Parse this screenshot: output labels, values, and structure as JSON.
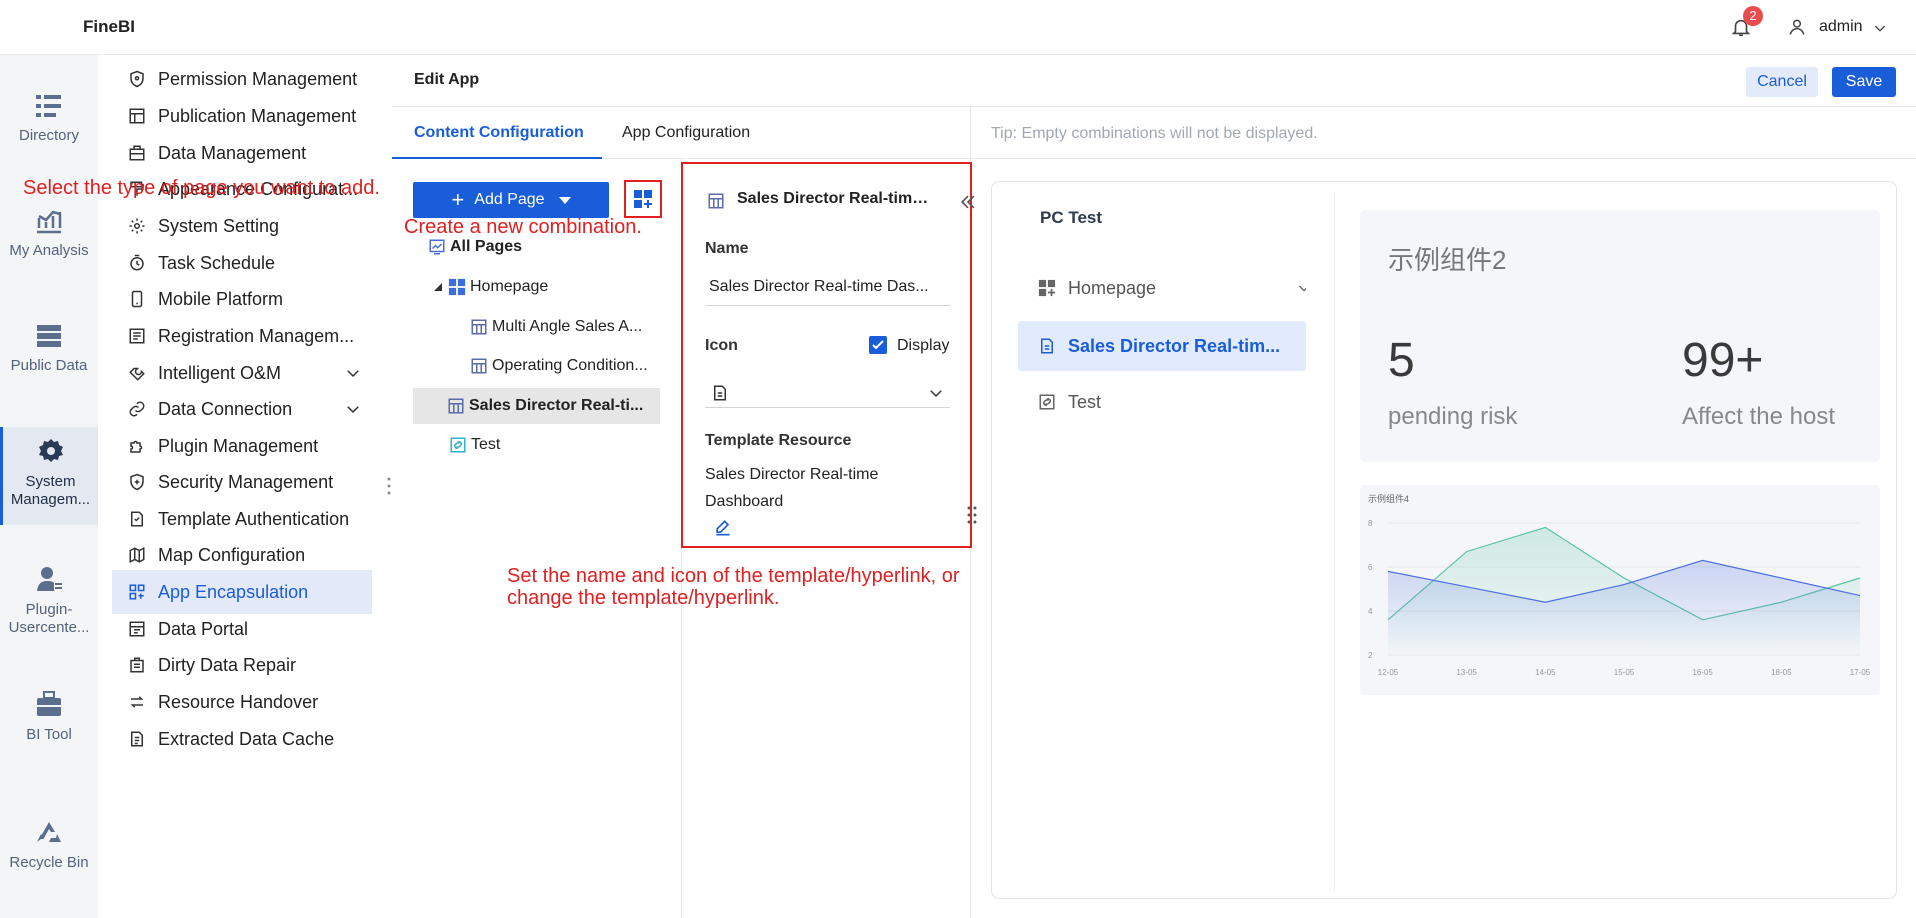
{
  "app": {
    "name": "FineBI"
  },
  "topbar": {
    "notification_count": "2",
    "username": "admin"
  },
  "rail": [
    {
      "label": "Directory",
      "icon": "directory-icon"
    },
    {
      "label": "My Analysis",
      "icon": "analysis-icon"
    },
    {
      "label": "Public Data",
      "icon": "public-data-icon"
    },
    {
      "label": "System Managem...",
      "icon": "gear-icon",
      "active": true
    },
    {
      "label": "Plugin-Usercente...",
      "icon": "user-plugin-icon"
    },
    {
      "label": "BI Tool",
      "icon": "toolbox-icon"
    },
    {
      "label": "Recycle Bin",
      "icon": "recycle-icon"
    }
  ],
  "menu": [
    {
      "label": "Permission Management"
    },
    {
      "label": "Publication Management"
    },
    {
      "label": "Data Management"
    },
    {
      "label": "Appearance Configurat..."
    },
    {
      "label": "System Setting"
    },
    {
      "label": "Task Schedule"
    },
    {
      "label": "Mobile Platform"
    },
    {
      "label": "Registration Managem..."
    },
    {
      "label": "Intelligent O&M"
    },
    {
      "label": "Data Connection"
    },
    {
      "label": "Plugin Management"
    },
    {
      "label": "Security Management"
    },
    {
      "label": "Template Authentication"
    },
    {
      "label": "Map Configuration"
    },
    {
      "label": "App Encapsulation"
    },
    {
      "label": "Data Portal"
    },
    {
      "label": "Dirty Data Repair"
    },
    {
      "label": "Resource Handover"
    },
    {
      "label": "Extracted Data Cache"
    }
  ],
  "edit": {
    "title": "Edit App",
    "cancel_label": "Cancel",
    "save_label": "Save",
    "tabs": [
      "Content Configuration",
      "App Configuration"
    ],
    "tip": "Tip: Empty combinations will not be displayed."
  },
  "tree": {
    "add_page_label": "Add Page",
    "items": [
      "All Pages",
      "Homepage",
      "Multi Angle Sales A...",
      "Operating Condition...",
      "Sales Director Real-ti...",
      "Test"
    ]
  },
  "config": {
    "title": "Sales Director Real-time ...",
    "name_label": "Name",
    "name_value": "Sales Director Real-time Das...",
    "icon_label": "Icon",
    "display_label": "Display",
    "template_resource_label": "Template Resource",
    "template_resource_value": "Sales Director Real-time Dashboard"
  },
  "preview": {
    "title": "PC Test",
    "items": [
      "Homepage",
      "Sales Director Real-tim...",
      "Test"
    ],
    "kpi": {
      "title": "示例组件2",
      "values": [
        {
          "num": "5",
          "caption": "pending risk"
        },
        {
          "num": "99+",
          "caption": "Affect the host"
        }
      ]
    }
  },
  "chart_data": {
    "type": "area",
    "title": "示例组件4",
    "categories": [
      "12-05",
      "13-05",
      "14-05",
      "15-05",
      "16-05",
      "18-05",
      "17-05"
    ],
    "ylim": [
      2,
      8
    ],
    "yticks": [
      "8",
      "6",
      "4",
      "2"
    ],
    "series": [
      {
        "values": [
          3.6,
          6.7,
          7.8,
          5.5,
          3.6,
          4.4,
          5.5
        ],
        "color": "#5cc3a5"
      },
      {
        "values": [
          5.8,
          5.1,
          4.4,
          5.2,
          6.3,
          5.5,
          4.7
        ],
        "color": "#4d6fe0"
      }
    ]
  },
  "annotations": {
    "page_type": "Select the type of page you want to add.",
    "combination": "Create a new combination.",
    "config": "Set the name and icon of the template/hyperlink, or change the template/hyperlink."
  }
}
